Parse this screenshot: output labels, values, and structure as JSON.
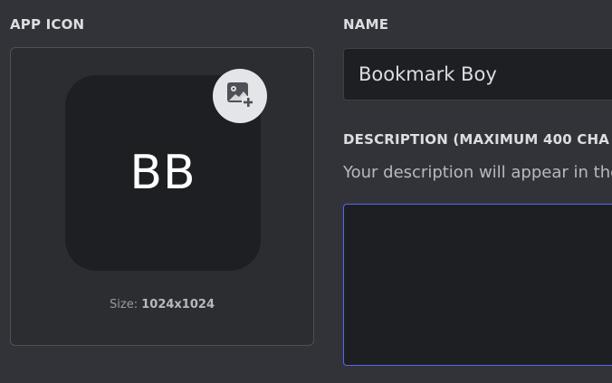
{
  "app_icon": {
    "section_label": "APP ICON",
    "initials": "BB",
    "upload_icon": "add-image-icon",
    "size_prefix": "Size:",
    "size_value": "1024x1024"
  },
  "name": {
    "section_label": "NAME",
    "value": "Bookmark Boy"
  },
  "description": {
    "section_label": "DESCRIPTION (MAXIMUM 400 CHA",
    "help_text": "Your description will appear in the",
    "value": ""
  },
  "colors": {
    "background": "#313338",
    "input_background": "#1e1f22",
    "focus_border": "#5865f2"
  }
}
